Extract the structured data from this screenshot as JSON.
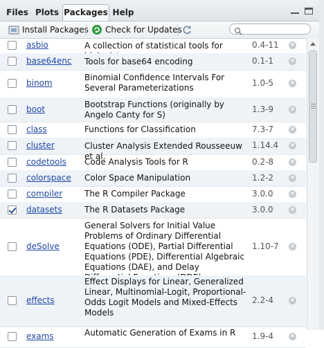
{
  "tabs": [
    "Files",
    "Plots",
    "Packages",
    "Help"
  ],
  "active_tab": "Packages",
  "toolbar": {
    "install_label": "Install Packages",
    "check_label": "Check for Updates",
    "search_placeholder": ""
  },
  "packages": [
    {
      "name": "asbio",
      "desc": "A collection of statistical tools for biologists",
      "version": "0.4-11",
      "checked": false
    },
    {
      "name": "base64enc",
      "desc": "Tools for base64 encoding",
      "version": "0.1-1",
      "checked": false
    },
    {
      "name": "binom",
      "desc": "Binomial Confidence Intervals For Several Parameterizations",
      "version": "1.0-5",
      "checked": false
    },
    {
      "name": "boot",
      "desc": "Bootstrap Functions (originally by Angelo Canty for S)",
      "version": "1.3-9",
      "checked": false
    },
    {
      "name": "class",
      "desc": "Functions for Classification",
      "version": "7.3-7",
      "checked": false
    },
    {
      "name": "cluster",
      "desc": "Cluster Analysis Extended Rousseeuw et al.",
      "version": "1.14.4",
      "checked": false
    },
    {
      "name": "codetools",
      "desc": "Code Analysis Tools for R",
      "version": "0.2-8",
      "checked": false
    },
    {
      "name": "colorspace",
      "desc": "Color Space Manipulation",
      "version": "1.2-2",
      "checked": false
    },
    {
      "name": "compiler",
      "desc": "The R Compiler Package",
      "version": "3.0.0",
      "checked": false
    },
    {
      "name": "datasets",
      "desc": "The R Datasets Package",
      "version": "3.0.0",
      "checked": true
    },
    {
      "name": "deSolve",
      "desc": "General Solvers for Initial Value Problems of Ordinary Differential Equations (ODE), Partial Differential Equations (PDE), Differential Algebraic Equations (DAE), and Delay Differential Equations (DDE)",
      "version": "1.10-7",
      "checked": false
    },
    {
      "name": "effects",
      "desc": "Effect Displays for Linear, Generalized Linear, Multinomial-Logit, Proportional-Odds Logit Models and Mixed-Effects Models",
      "version": "2.2-4",
      "checked": false
    },
    {
      "name": "exams",
      "desc": "Automatic Generation of Exams in R",
      "version": "1.9-4",
      "checked": false
    }
  ]
}
